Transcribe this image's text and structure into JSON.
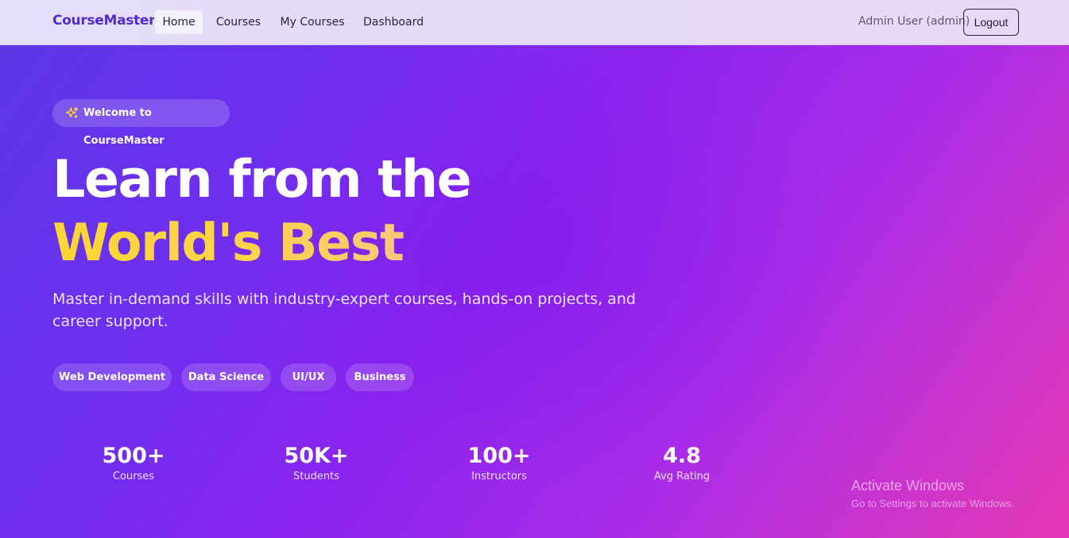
{
  "nav": {
    "brand": "CourseMaster",
    "links": [
      "Home",
      "Courses",
      "My Courses",
      "Dashboard"
    ],
    "active_link": "Home",
    "user": "Admin User (admin)",
    "logout": "Logout"
  },
  "hero": {
    "badge": {
      "icon": "sparkles-icon",
      "label": "Welcome to CourseMaster"
    },
    "headline_line1": "Learn from the",
    "headline_line2": "World's Best",
    "subtitle": "Master in-demand skills with industry-expert courses, hands-on projects, and career support.",
    "tags": [
      "Web Development",
      "Data Science",
      "UI/UX",
      "Business"
    ],
    "stats": [
      {
        "value": "500+",
        "label": "Courses"
      },
      {
        "value": "50K+",
        "label": "Students"
      },
      {
        "value": "100+",
        "label": "Instructors"
      },
      {
        "value": "4.8",
        "label": "Avg Rating"
      }
    ]
  },
  "watermark": {
    "title": "Activate Windows",
    "subtitle": "Go to Settings to activate Windows."
  },
  "colors": {
    "brand": "#4f2fc9",
    "accent_yellow": "#fcd535",
    "hero_start": "#5c37e6",
    "hero_end": "#e338b4"
  }
}
